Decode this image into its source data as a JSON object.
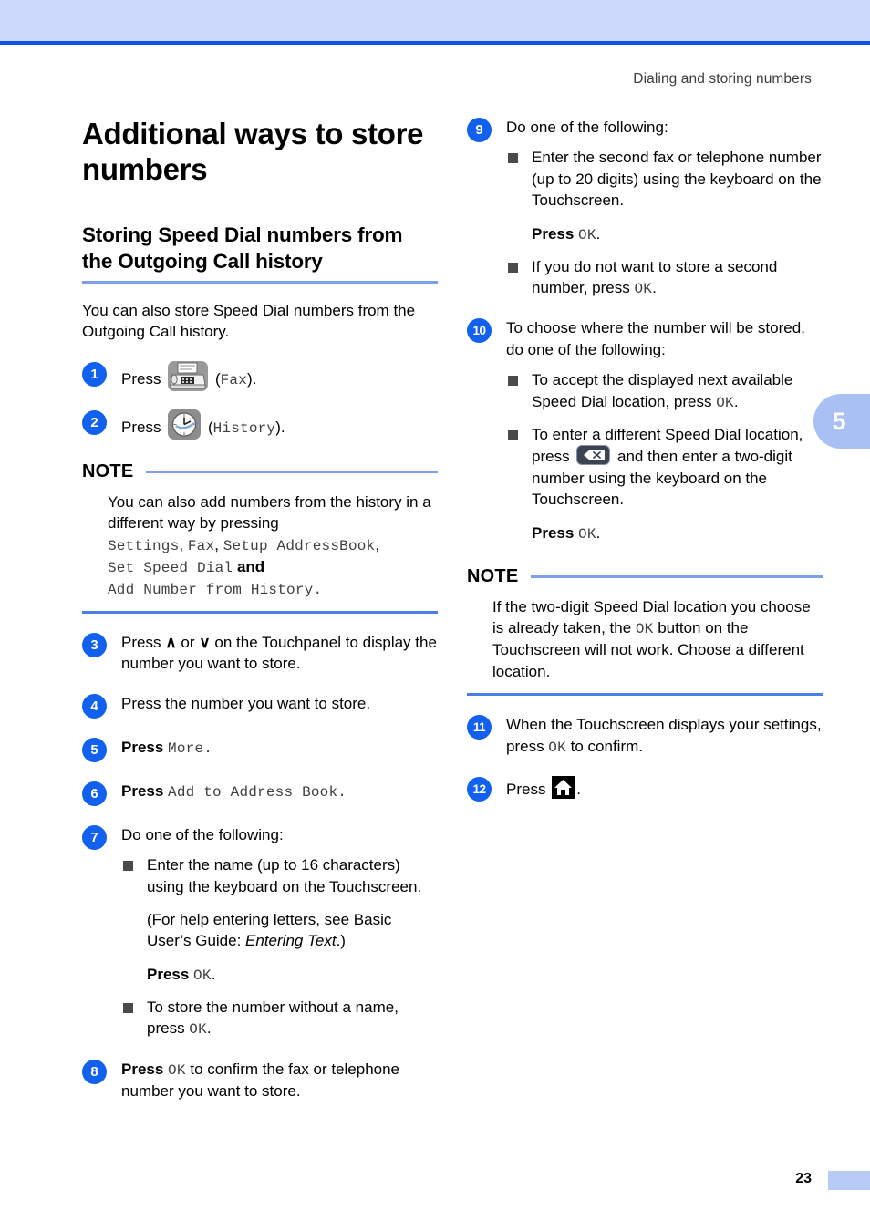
{
  "header": {
    "running_head": "Dialing and storing numbers"
  },
  "chapter_tab": {
    "number": "5"
  },
  "footer": {
    "page_number": "23"
  },
  "left_column": {
    "page_title": "Additional ways to store numbers",
    "section_title": "Storing Speed Dial numbers from the Outgoing Call history",
    "intro": "You can also store Speed Dial numbers from the Outgoing Call history.",
    "steps": [
      {
        "number": "1",
        "press_label": "Press",
        "icon": "fax-icon",
        "paren_mono": "Fax",
        "trailing": "."
      },
      {
        "number": "2",
        "press_label": "Press",
        "icon": "history-clock-icon",
        "paren_mono": "History",
        "trailing": "."
      },
      {
        "number": "3",
        "text_before_up": "Press ",
        "up_arrow": "∧",
        "or_text": " or ",
        "down_arrow": "∨",
        "text_after": " on the Touchpanel to display the number you want to store."
      },
      {
        "number": "4",
        "text": "Press the number you want to store."
      },
      {
        "number": "5",
        "prefix": "Press ",
        "mono": "More",
        "suffix": "."
      },
      {
        "number": "6",
        "prefix": "Press ",
        "mono": "Add to Address Book",
        "suffix": "."
      },
      {
        "number": "7",
        "lead": "Do one of the following:",
        "bullets": [
          {
            "text": "Enter the name (up to 16 characters) using the keyboard on the Touchscreen.",
            "sub_paren_prefix": "(For help entering letters, see Basic User’s Guide: ",
            "sub_paren_italic": "Entering Text",
            "sub_paren_suffix": ".)",
            "sub_press_prefix": "Press ",
            "sub_press_mono": "OK",
            "sub_press_suffix": "."
          },
          {
            "text_prefix": "To store the number without a name, press ",
            "text_mono": "OK",
            "text_suffix": "."
          }
        ]
      },
      {
        "number": "8",
        "prefix": "Press ",
        "mono": "OK",
        "suffix": " to confirm the fax or telephone number you want to store."
      }
    ],
    "note": {
      "label": "NOTE",
      "line1": "You can also add numbers from the history in a different way by pressing",
      "mono_line1": "Settings",
      "mono_sep1": ", ",
      "mono_line2": "Fax",
      "mono_sep2": ", ",
      "mono_line3": "Setup AddressBook",
      "mono_sep3": ", ",
      "mono_line4": "Set Speed Dial",
      "and_text": " and ",
      "mono_line5": "Add Number from History",
      "end_text": "."
    }
  },
  "right_column": {
    "steps": [
      {
        "number": "9",
        "lead": "Do one of the following:",
        "bullets": [
          {
            "text": "Enter the second fax or telephone number (up to 20 digits) using the keyboard on the Touchscreen.",
            "sub_press_prefix": "Press ",
            "sub_press_mono": "OK",
            "sub_press_suffix": "."
          },
          {
            "text_prefix": "If you do not want to store a second number, press ",
            "text_mono": "OK",
            "text_suffix": "."
          }
        ]
      },
      {
        "number": "10",
        "lead": "To choose where the number will be stored, do one of the following:",
        "bullets": [
          {
            "text_prefix": "To accept the displayed next available Speed Dial location, press ",
            "text_mono": "OK",
            "text_suffix": "."
          },
          {
            "text_prefix": "To enter a different Speed Dial location, press ",
            "icon": "backspace-icon",
            "text_suffix": " and then enter a two-digit number using the keyboard on the Touchscreen.",
            "sub_press_prefix": "Press ",
            "sub_press_mono": "OK",
            "sub_press_suffix": "."
          }
        ]
      },
      {
        "number": "11",
        "prefix": "When the Touchscreen displays your settings, press ",
        "mono": "OK",
        "suffix": " to confirm."
      },
      {
        "number": "12",
        "prefix": "Press ",
        "icon": "home-icon",
        "suffix": "."
      }
    ],
    "note": {
      "label": "NOTE",
      "text_prefix": "If the two-digit Speed Dial location you choose is already taken, the ",
      "text_mono": "OK",
      "text_suffix": " button on the Touchscreen will not work. Choose a different location."
    }
  },
  "colors": {
    "band": "#ccd9fc",
    "rule": "#0d52e8",
    "step_circle": "#1160ee",
    "note_rule_light": "#7f9fee",
    "note_rule_dark": "#4a7fe8",
    "tab": "#a8c0f4"
  }
}
